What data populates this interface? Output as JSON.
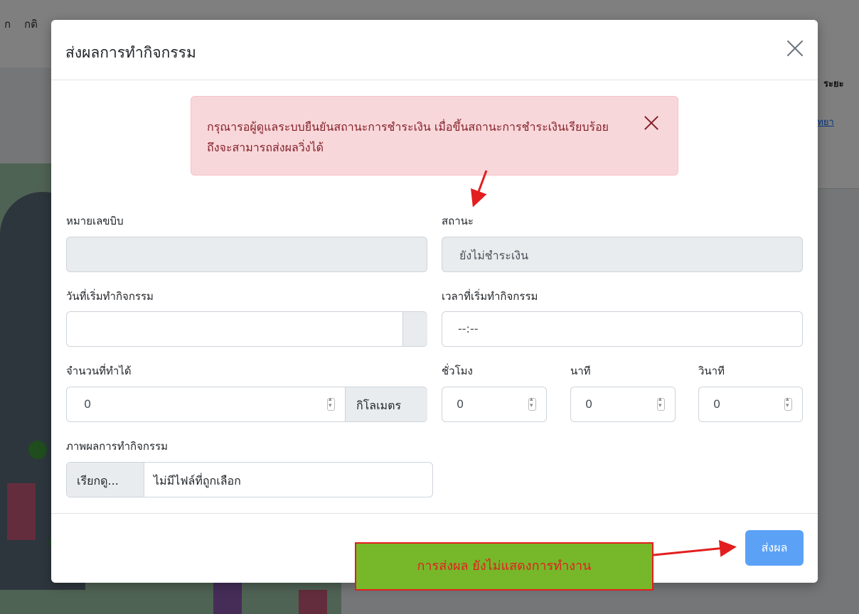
{
  "background": {
    "nav_items": [
      "ก",
      "กติ"
    ],
    "right_header": "ระยะ",
    "right_link": "วิทยา"
  },
  "modal": {
    "title": "ส่งผลการทำกิจกรรม",
    "close_icon": "close-icon",
    "alert": {
      "message": "กรุณารอผู้ดูแลระบบยืนยันสถานะการชำระเงิน เมื่อขึ้นสถานะการชำระเงินเรียบร้อย ถึงจะสามารถส่งผลวิ่งได้"
    },
    "fields": {
      "bib_label": "หมายเลขบิบ",
      "bib_value": "",
      "status_label": "สถานะ",
      "status_value": "ยังไม่ชำระเงิน",
      "start_date_label": "วันที่เริ่มทำกิจกรรม",
      "start_date_value": "",
      "start_time_label": "เวลาที่เริ่มทำกิจกรรม",
      "start_time_value": "--:--",
      "distance_label": "จำนวนที่ทำได้",
      "distance_value": "0",
      "distance_unit": "กิโลเมตร",
      "hours_label": "ชั่วโมง",
      "hours_value": "0",
      "minutes_label": "นาที",
      "minutes_value": "0",
      "seconds_label": "วินาที",
      "seconds_value": "0",
      "image_label": "ภาพผลการทำกิจกรรม",
      "browse_label": "เรียกดู...",
      "no_file_text": "ไม่มีไฟล์ที่ถูกเลือก"
    },
    "submit_label": "ส่งผล"
  },
  "annotation": {
    "note_text": "การส่งผล ยังไม่แสดงการทำงาน",
    "color": "#e31e1e",
    "note_bg": "#76b82a"
  }
}
